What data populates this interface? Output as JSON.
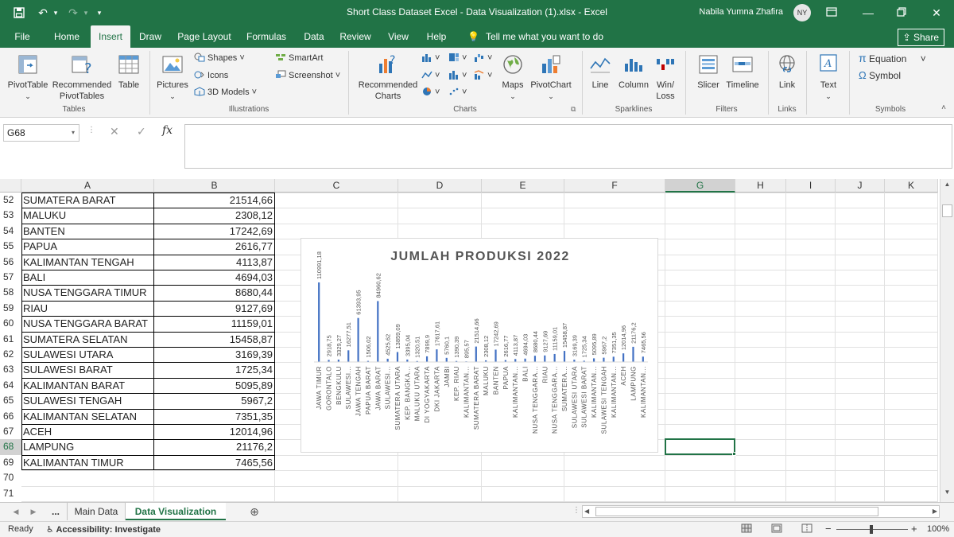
{
  "title": "Short Class Dataset Excel - Data Visualization (1).xlsx  -  Excel",
  "user": {
    "name": "Nabila Yumna Zhafira",
    "initials": "NY"
  },
  "tabs": [
    "File",
    "Home",
    "Insert",
    "Draw",
    "Page Layout",
    "Formulas",
    "Data",
    "Review",
    "View",
    "Help"
  ],
  "active_tab": "Insert",
  "tell_me": "Tell me what you want to do",
  "share": "Share",
  "ribbon": {
    "tables": {
      "pivottable": "PivotTable",
      "recommended": "Recommended",
      "pivottables": "PivotTables",
      "table": "Table",
      "label": "Tables"
    },
    "illustrations": {
      "pictures": "Pictures",
      "shapes": "Shapes",
      "icons": "Icons",
      "models3d": "3D Models",
      "smartart": "SmartArt",
      "screenshot": "Screenshot",
      "label": "Illustrations"
    },
    "charts": {
      "recommended": "Recommended",
      "charts": "Charts",
      "maps": "Maps",
      "pivotchart": "PivotChart",
      "label": "Charts"
    },
    "sparklines": {
      "line": "Line",
      "column": "Column",
      "winloss1": "Win/",
      "winloss2": "Loss",
      "label": "Sparklines"
    },
    "filters": {
      "slicer": "Slicer",
      "timeline": "Timeline",
      "label": "Filters"
    },
    "links": {
      "link": "Link",
      "label": "Links"
    },
    "text": {
      "text": "Text"
    },
    "symbols": {
      "equation": "Equation",
      "symbol": "Symbol",
      "label": "Symbols"
    }
  },
  "name_box": "G68",
  "columns": [
    "A",
    "B",
    "C",
    "D",
    "E",
    "F",
    "G",
    "H",
    "I",
    "J",
    "K"
  ],
  "selected_column": "G",
  "selected_row": "68",
  "rows": [
    {
      "num": "52",
      "a": "SUMATERA BARAT",
      "b": "21514,66"
    },
    {
      "num": "53",
      "a": "MALUKU",
      "b": "2308,12"
    },
    {
      "num": "54",
      "a": "BANTEN",
      "b": "17242,69"
    },
    {
      "num": "55",
      "a": "PAPUA",
      "b": "2616,77"
    },
    {
      "num": "56",
      "a": "KALIMANTAN TENGAH",
      "b": "4113,87"
    },
    {
      "num": "57",
      "a": "BALI",
      "b": "4694,03"
    },
    {
      "num": "58",
      "a": "NUSA TENGGARA TIMUR",
      "b": "8680,44"
    },
    {
      "num": "59",
      "a": "RIAU",
      "b": "9127,69"
    },
    {
      "num": "60",
      "a": "NUSA TENGGARA BARAT",
      "b": "11159,01"
    },
    {
      "num": "61",
      "a": "SUMATERA SELATAN",
      "b": "15458,87"
    },
    {
      "num": "62",
      "a": "SULAWESI UTARA",
      "b": "3169,39"
    },
    {
      "num": "63",
      "a": "SULAWESI BARAT",
      "b": "1725,34"
    },
    {
      "num": "64",
      "a": "KALIMANTAN BARAT",
      "b": "5095,89"
    },
    {
      "num": "65",
      "a": "SULAWESI TENGAH",
      "b": "5967,2"
    },
    {
      "num": "66",
      "a": "KALIMANTAN SELATAN",
      "b": "7351,35"
    },
    {
      "num": "67",
      "a": "ACEH",
      "b": "12014,96"
    },
    {
      "num": "68",
      "a": "LAMPUNG",
      "b": "21176,2"
    },
    {
      "num": "69",
      "a": "KALIMANTAN TIMUR",
      "b": "7465,56"
    },
    {
      "num": "70",
      "a": "",
      "b": ""
    },
    {
      "num": "71",
      "a": "",
      "b": ""
    }
  ],
  "chart_data": {
    "type": "bar",
    "title": "JUMLAH PRODUKSI 2022",
    "color": "#4472c4",
    "categories": [
      "JAWA TIMUR",
      "GORONTALO",
      "BENGKULU",
      "SULAWESI...",
      "JAWA TENGAH",
      "PAPUA BARAT",
      "JAWA BARAT",
      "SULAWESI...",
      "SUMATERA UTARA",
      "KEP. BANGKA...",
      "MALUKU UTARA",
      "DI YOGYAKARTA",
      "DKI JAKARTA",
      "JAMBI",
      "KEP. RIAU",
      "KALIMANTAN...",
      "SUMATERA BARAT",
      "MALUKU",
      "BANTEN",
      "PAPUA",
      "KALIMANTAN...",
      "BALI",
      "NUSA TENGGARA...",
      "RIAU",
      "NUSA TENGGARA...",
      "SUMATERA...",
      "SULAWESI UTARA",
      "SULAWESI BARAT",
      "KALIMANTAN...",
      "SULAWESI TENGAH",
      "KALIMANTAN...",
      "ACEH",
      "LAMPUNG",
      "KALIMANTAN..."
    ],
    "values": [
      110991.18,
      2918.75,
      3329.27,
      16277.51,
      61393.95,
      1506.02,
      84960.62,
      4525.62,
      13859.09,
      3395.04,
      1320.51,
      7899.9,
      17617.61,
      5760.1,
      1390.39,
      895.57,
      21514.66,
      2308.12,
      17242.69,
      2616.77,
      4113.87,
      4694.03,
      8680.44,
      9127.69,
      11159.01,
      15458.87,
      3169.39,
      1725.34,
      5095.89,
      5967.2,
      7351.35,
      12014.96,
      21176.2,
      7465.56
    ],
    "labels": [
      "110991,18",
      "2918,75",
      "3329,27",
      "16277,51",
      "61393,95",
      "1506,02",
      "84960,62",
      "4525,62",
      "13859,09",
      "3395,04",
      "1320,51",
      "7899,9",
      "17617,61",
      "5760,1",
      "1390,39",
      "895,57",
      "21514,66",
      "2308,12",
      "17242,69",
      "2616,77",
      "4113,87",
      "4694,03",
      "8680,44",
      "9127,69",
      "11159,01",
      "15458,87",
      "3169,39",
      "1725,34",
      "5095,89",
      "5967,2",
      "7351,35",
      "12014,96",
      "21176,2",
      "7465,56"
    ],
    "ylim": [
      0,
      110991.18
    ]
  },
  "sheets": {
    "more": "...",
    "main": "Main Data",
    "viz": "Data Visualization"
  },
  "status": {
    "ready": "Ready",
    "accessibility": "Accessibility: Investigate",
    "zoom": "100%"
  }
}
